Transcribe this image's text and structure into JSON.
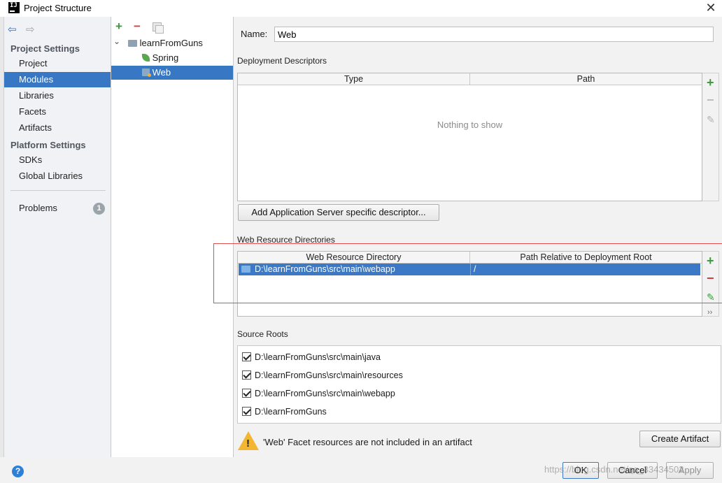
{
  "window": {
    "title": "Project Structure",
    "app_icon_text": "IJ",
    "close_glyph": "✕"
  },
  "nav": {
    "back_glyph": "⇦",
    "forward_glyph": "⇨"
  },
  "sidebar": {
    "sections": [
      {
        "title": "Project Settings",
        "items": [
          "Project",
          "Modules",
          "Libraries",
          "Facets",
          "Artifacts"
        ]
      },
      {
        "title": "Platform Settings",
        "items": [
          "SDKs",
          "Global Libraries"
        ]
      }
    ],
    "selected": "Modules",
    "problems": {
      "label": "Problems",
      "count": "1"
    }
  },
  "tree": {
    "toolbar": {
      "add": "+",
      "remove": "−"
    },
    "items": [
      {
        "label": "learnFromGuns",
        "icon": "module-folder-icon",
        "expanded": true
      },
      {
        "label": "Spring",
        "icon": "spring-leaf-icon"
      },
      {
        "label": "Web",
        "icon": "web-facet-icon",
        "selected": true
      }
    ],
    "expander_glyph": "⌄"
  },
  "facet": {
    "name_label": "Name:",
    "name_value": "Web",
    "deployment": {
      "title": "Deployment Descriptors",
      "columns": [
        "Type",
        "Path"
      ],
      "empty_text": "Nothing to show",
      "add_button": "Add Application Server specific descriptor..."
    },
    "web_resources": {
      "title": "Web Resource Directories",
      "columns": [
        "Web Resource Directory",
        "Path Relative to Deployment Root"
      ],
      "rows": [
        {
          "directory": "D:\\learnFromGuns\\src\\main\\webapp",
          "relative_path": "/"
        }
      ]
    },
    "source_roots": {
      "title": "Source Roots",
      "items": [
        {
          "path": "D:\\learnFromGuns\\src\\main\\java",
          "checked": true
        },
        {
          "path": "D:\\learnFromGuns\\src\\main\\resources",
          "checked": true
        },
        {
          "path": "D:\\learnFromGuns\\src\\main\\webapp",
          "checked": true
        },
        {
          "path": "D:\\learnFromGuns",
          "checked": true
        }
      ]
    },
    "warning": {
      "text": "'Web' Facet resources are not included in an artifact",
      "mark": "!"
    },
    "create_artifact_button": "Create Artifact"
  },
  "side_tools": {
    "add": "+",
    "remove": "−",
    "edit": "✎",
    "more": "››"
  },
  "footer": {
    "help": "?",
    "ok": "OK",
    "cancel": "Cancel",
    "apply": "Apply",
    "watermark": "https://blog.csdn.net/qq_33434502"
  },
  "colors": {
    "selection": "#3877c3",
    "add_green": "#3d9a3d",
    "remove_red": "#d33a3a",
    "highlight_box": "#e05050",
    "warning": "#f2b632"
  }
}
